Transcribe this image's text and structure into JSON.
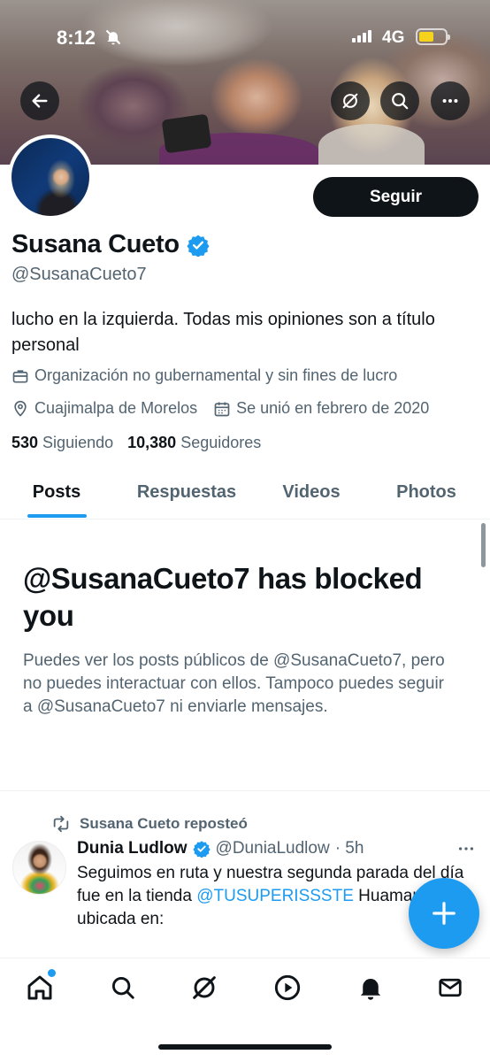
{
  "status_bar": {
    "time": "8:12",
    "network": "4G"
  },
  "profile": {
    "name": "Susana Cueto",
    "handle": "@SusanaCueto7",
    "bio": "lucho en la izquierda. Todas mis opiniones son a título personal",
    "category": "Organización no gubernamental y sin fines de lucro",
    "location": "Cuajimalpa de Morelos",
    "joined": "Se unió en febrero de 2020",
    "following_count": "530",
    "following_label": "Siguiendo",
    "followers_count": "10,380",
    "followers_label": "Seguidores",
    "follow_button": "Seguir"
  },
  "tabs": [
    {
      "label": "Posts",
      "active": true
    },
    {
      "label": "Respuestas",
      "active": false
    },
    {
      "label": "Videos",
      "active": false
    },
    {
      "label": "Photos",
      "active": false
    }
  ],
  "blocked": {
    "title": "@SusanaCueto7 has blocked you",
    "text": "Puedes ver los posts públicos de @SusanaCueto7, pero no puedes interactuar con ellos. Tampoco puedes seguir a @SusanaCueto7 ni enviarle mensajes."
  },
  "post": {
    "repost_label": "Susana Cueto reposteó",
    "author_name": "Dunia Ludlow",
    "author_handle": "@DuniaLudlow",
    "time": "· 5h",
    "text_before": "Seguimos en ruta y nuestra segunda parada del día fue en la tienda ",
    "mention": "@TUSUPERISSSTE",
    "text_after": " Huamantla, ubicada en:"
  },
  "colors": {
    "accent": "#1d9bf0",
    "text": "#0f1419",
    "secondary": "#536471",
    "battery": "#f5d31c"
  },
  "icons": [
    "back-arrow-icon",
    "grok-icon",
    "search-icon",
    "more-icon",
    "verified-badge-icon",
    "briefcase-icon",
    "location-pin-icon",
    "calendar-icon",
    "repost-icon",
    "plus-icon",
    "home-icon",
    "explore-icon",
    "video-icon",
    "notifications-icon",
    "messages-icon"
  ]
}
